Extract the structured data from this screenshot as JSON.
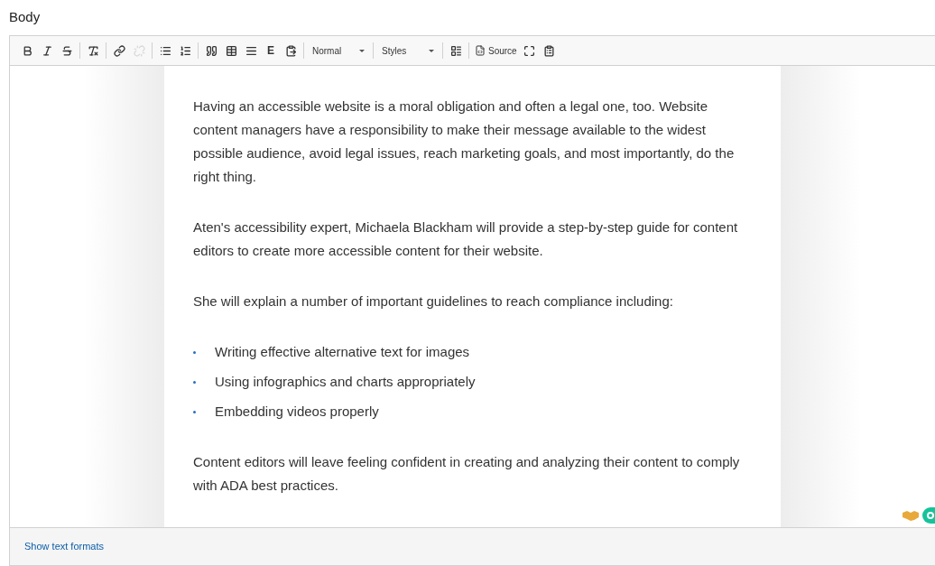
{
  "field_label": "Body",
  "toolbar": [
    {
      "kind": "bold",
      "disabled": false
    },
    {
      "kind": "italic",
      "disabled": false
    },
    {
      "kind": "strike",
      "disabled": false
    },
    {
      "kind": "sep"
    },
    {
      "kind": "clear",
      "disabled": false
    },
    {
      "kind": "sep"
    },
    {
      "kind": "link",
      "disabled": false
    },
    {
      "kind": "unlink",
      "disabled": true
    },
    {
      "kind": "sep"
    },
    {
      "kind": "bullets",
      "disabled": false
    },
    {
      "kind": "numbers",
      "disabled": false
    },
    {
      "kind": "sep"
    },
    {
      "kind": "quote",
      "disabled": false
    },
    {
      "kind": "table",
      "disabled": false
    },
    {
      "kind": "rule",
      "disabled": false
    },
    {
      "kind": "glyph",
      "label": "E",
      "disabled": false
    },
    {
      "kind": "paste",
      "disabled": false
    },
    {
      "kind": "sep"
    },
    {
      "kind": "dropdown",
      "label": "Normal"
    },
    {
      "kind": "sep"
    },
    {
      "kind": "dropdown",
      "label": "Styles"
    },
    {
      "kind": "sep"
    },
    {
      "kind": "blocks",
      "disabled": false
    },
    {
      "kind": "sep"
    },
    {
      "kind": "source",
      "label": "Source",
      "disabled": false
    },
    {
      "kind": "maximize",
      "disabled": false
    },
    {
      "kind": "template",
      "disabled": false
    }
  ],
  "content": [
    {
      "kind": "p",
      "text": "Having an accessible website is a moral obligation and often a legal one, too. Website content managers have a responsibility to make their message available to the widest possible audience, avoid legal issues, reach marketing goals, and most importantly, do the right thing."
    },
    {
      "kind": "p",
      "text": "Aten's accessibility expert, Michaela Blackham will provide a step-by-step guide for content editors to create more accessible content for their website."
    },
    {
      "kind": "p",
      "text": "She will explain a number of important guidelines to reach compliance including:"
    },
    {
      "kind": "list",
      "items": [
        "Writing effective alternative text for images",
        "Using infographics and charts appropriately",
        "Embedding videos properly"
      ]
    },
    {
      "kind": "p",
      "text": "Content editors will leave feeling confident in creating and analyzing their content to comply with ADA best practices."
    }
  ],
  "footer_link": "Show text formats"
}
